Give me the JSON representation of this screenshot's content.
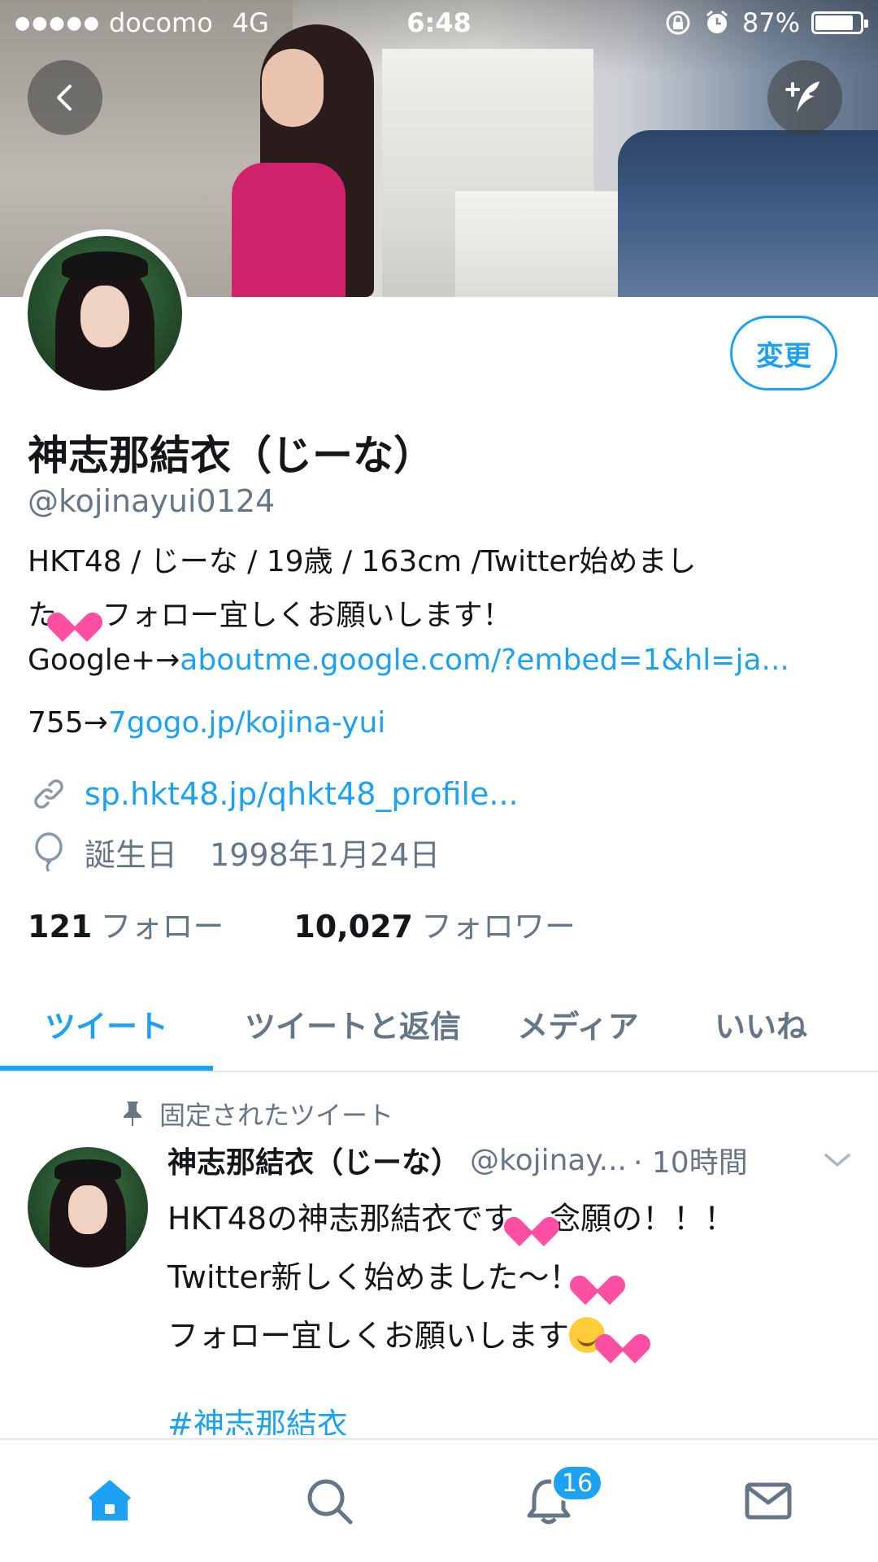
{
  "status_bar": {
    "carrier": "docomo",
    "network": "4G",
    "time": "6:48",
    "battery": "87%",
    "battery_level": 0.87
  },
  "profile": {
    "edit_label": "変更",
    "name": "神志那結衣（じーな）",
    "handle": "@kojinayui0124",
    "bio": {
      "line1": "HKT48 / じーな / 19歳 / 163cm /Twitter始めまし",
      "line2_pre": "た",
      "line2_post": "フォロー宜しくお願いします！",
      "line3_pre": "Google+→",
      "line3_link": "aboutme.google.com/?embed=1&hl=ja...",
      "line4_pre": "755→",
      "line4_link": "7gogo.jp/kojina-yui"
    },
    "website": "sp.hkt48.jp/qhkt48_profile...",
    "birthday_label": "誕生日",
    "birthday_value": "1998年1月24日",
    "following_count": "121",
    "following_label": "フォロー",
    "followers_count": "10,027",
    "followers_label": "フォロワー"
  },
  "tabs": [
    {
      "label": "ツイート"
    },
    {
      "label": "ツイートと返信"
    },
    {
      "label": "メディア"
    },
    {
      "label": "いいね"
    }
  ],
  "pinned_tweet": {
    "pinned_label": "固定されたツイート",
    "author_name": "神志那結衣（じーな）",
    "author_handle": "@kojinay...",
    "time": "· 10時間",
    "line1_pre": "HKT48の神志那結衣です",
    "line1_post": "念願の！！！",
    "line2": "Twitter新しく始めました〜！",
    "line3": "フォロー宜しくお願いします",
    "hashtag": "#神志那結衣"
  },
  "bottom_nav": {
    "notifications_badge": "16",
    "icons": [
      "home-icon",
      "search-icon",
      "bell-icon",
      "mail-icon"
    ]
  },
  "colors": {
    "accent": "#1da1f2",
    "muted": "#657786",
    "text": "#14171a"
  }
}
